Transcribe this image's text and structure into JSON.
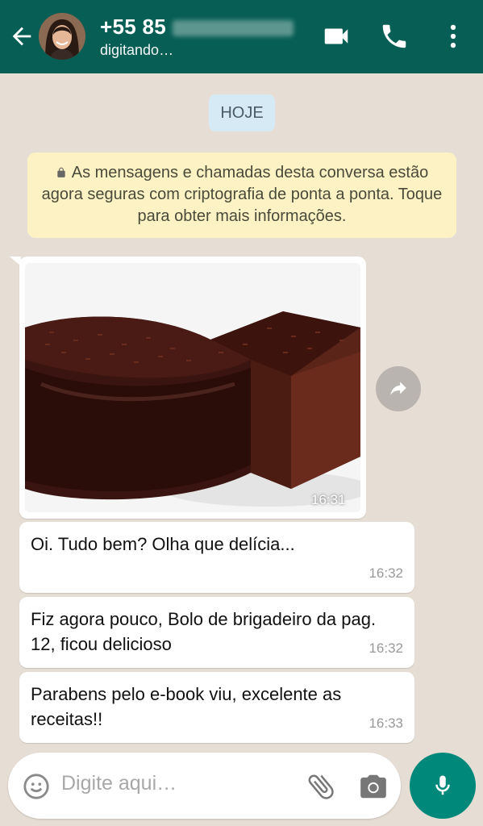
{
  "header": {
    "contact_name": "+55 85",
    "status": "digitando…",
    "colors": {
      "bar": "#075e54"
    },
    "icons": [
      "back-arrow-icon",
      "video-call-icon",
      "phone-icon",
      "more-vert-icon"
    ]
  },
  "chat": {
    "date_label": "HOJE",
    "encryption_notice": "As mensagens e chamadas desta conversa estão agora seguras com criptografia de ponta a ponta. Toque para obter mais informações.",
    "image_message": {
      "time": "16:31"
    },
    "messages": [
      {
        "text": "Oi. Tudo bem? Olha que delícia...",
        "time": "16:32"
      },
      {
        "text": "Fiz agora pouco, Bolo de brigadeiro da pag. 12, ficou delicioso",
        "time": "16:32"
      },
      {
        "text": "Parabens pelo e-book viu, excelente as receitas!!",
        "time": "16:33"
      }
    ]
  },
  "composer": {
    "placeholder": "Digite aqui…",
    "icons": [
      "emoji-icon",
      "attach-icon",
      "camera-icon",
      "mic-icon"
    ],
    "colors": {
      "mic_button": "#00897b"
    }
  }
}
